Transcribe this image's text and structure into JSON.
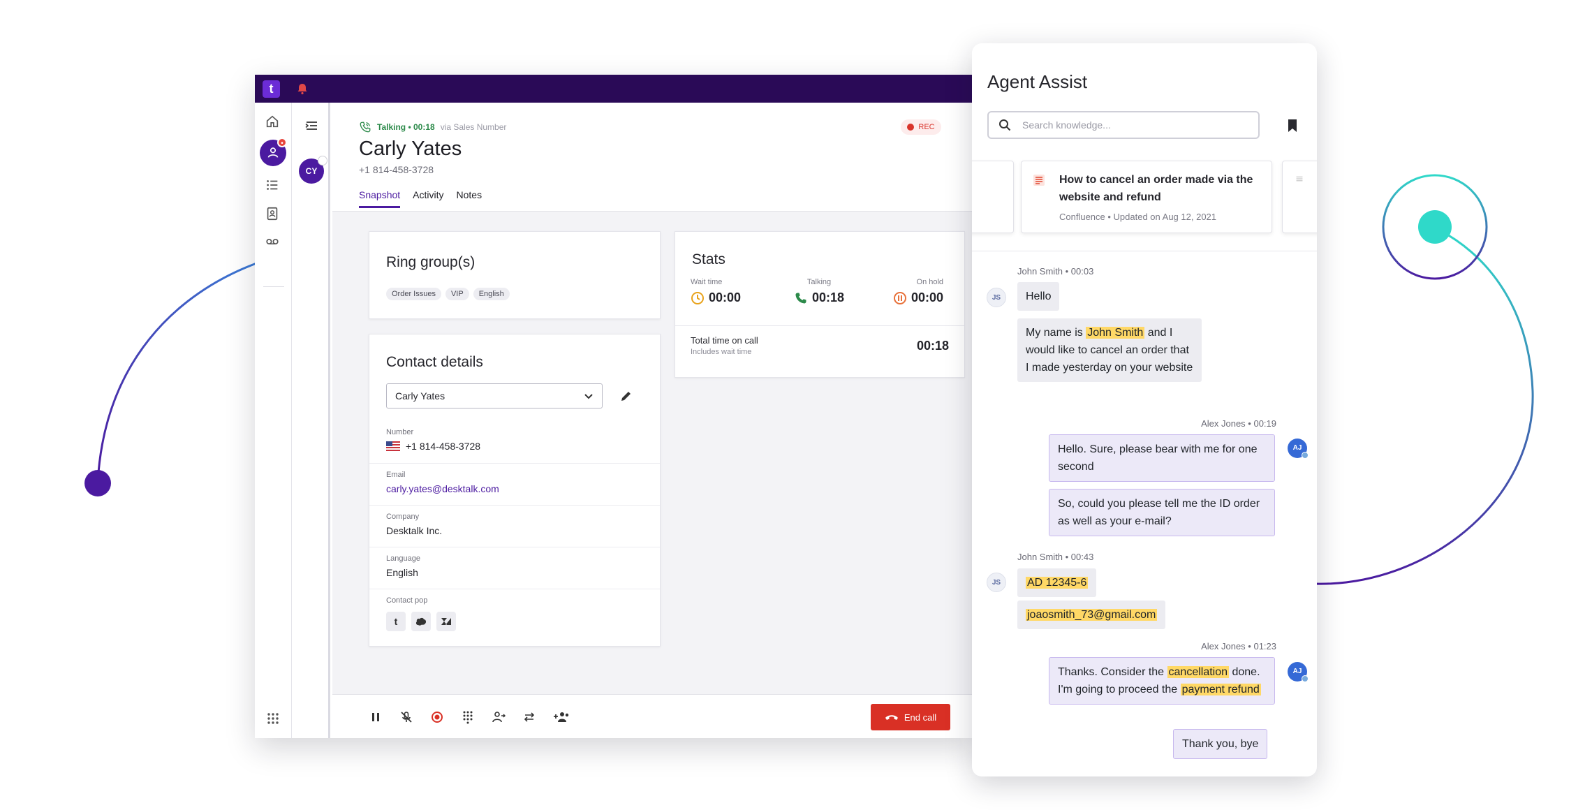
{
  "app": {
    "logo_text": "t",
    "queue_avatar": "CY"
  },
  "header": {
    "status": "Talking • 00:18",
    "via": "via Sales Number",
    "name": "Carly Yates",
    "phone": "+1 814-458-3728",
    "rec": "REC",
    "tabs": [
      "Snapshot",
      "Activity",
      "Notes"
    ]
  },
  "ring_groups": {
    "title": "Ring group(s)",
    "chips": [
      "Order Issues",
      "VIP",
      "English"
    ]
  },
  "stats": {
    "title": "Stats",
    "wait_label": "Wait time",
    "wait_value": "00:00",
    "talking_label": "Talking",
    "talking_value": "00:18",
    "hold_label": "On hold",
    "hold_value": "00:00",
    "total_label": "Total time on call",
    "total_sub": "Includes wait time",
    "total_value": "00:18"
  },
  "contact": {
    "title": "Contact details",
    "selected": "Carly Yates",
    "number_label": "Number",
    "number_value": "+1 814-458-3728",
    "email_label": "Email",
    "email_value": "carly.yates@desktalk.com",
    "company_label": "Company",
    "company_value": "Desktalk Inc.",
    "language_label": "Language",
    "language_value": "English",
    "pop_label": "Contact pop"
  },
  "bottom": {
    "end_call": "End call"
  },
  "assist": {
    "title": "Agent Assist",
    "search_placeholder": "Search knowledge...",
    "kb_title": "How to cancel an order made via the website and refund",
    "kb_meta": "Confluence • Updated on Aug 12, 2021"
  },
  "chat": {
    "m1_hdr": "John Smith • 00:03",
    "m1_a": "Hello",
    "m1_b_pre": "My name is ",
    "m1_b_hl": "John Smith",
    "m1_b_post": " and I would like to cancel an order that I made yesterday on your website",
    "m2_hdr": "Alex Jones • 00:19",
    "m2_a": "Hello. Sure, please bear with me for one second",
    "m2_b": "So, could you please tell me the ID order as well as your e-mail?",
    "m3_hdr": "John Smith • 00:43",
    "m3_a": "AD 12345-6",
    "m3_b": "joaosmith_73@gmail.com",
    "m4_hdr": "Alex Jones • 01:23",
    "m4_a_pre": "Thanks. Consider the ",
    "m4_a_hl1": "cancellation",
    "m4_a_mid": " done. I'm going to proceed the ",
    "m4_a_hl2": "payment refund",
    "m4_b": "Thank you, bye",
    "av_js": "JS",
    "av_aj": "AJ"
  },
  "colors": {
    "brand_dark": "#2a0a57",
    "brand": "#4b1aa0",
    "end_call": "#d93025",
    "highlight": "#ffd866"
  }
}
